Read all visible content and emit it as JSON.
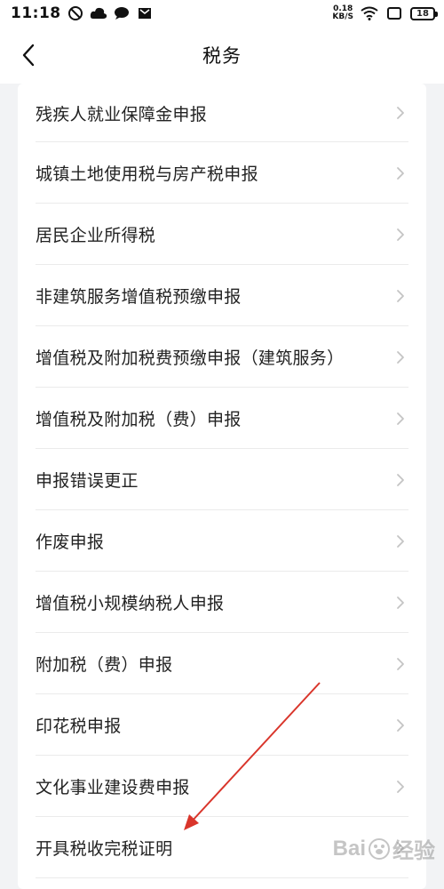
{
  "status_bar": {
    "time": "11:18",
    "net_speed_value": "0.18",
    "net_speed_unit": "KB/S",
    "battery": "18",
    "icons": [
      "alarm-off-icon",
      "cloud-icon",
      "chat-bubble-icon",
      "mail-icon",
      "wifi-icon",
      "screen-icon"
    ]
  },
  "nav": {
    "title": "税务",
    "back_icon": "chevron-left-icon"
  },
  "menu": {
    "items": [
      {
        "label": "残疾人就业保障金申报"
      },
      {
        "label": "城镇土地使用税与房产税申报"
      },
      {
        "label": "居民企业所得税"
      },
      {
        "label": "非建筑服务增值税预缴申报"
      },
      {
        "label": "增值税及附加税费预缴申报（建筑服务）"
      },
      {
        "label": "增值税及附加税（费）申报"
      },
      {
        "label": "申报错误更正"
      },
      {
        "label": "作废申报"
      },
      {
        "label": "增值税小规模纳税人申报"
      },
      {
        "label": "附加税（费）申报"
      },
      {
        "label": "印花税申报"
      },
      {
        "label": "文化事业建设费申报"
      },
      {
        "label": "开具税收完税证明"
      }
    ]
  },
  "colors": {
    "background": "#f2f3f5",
    "card": "#ffffff",
    "chevron": "#c4c4c4",
    "annotation_arrow": "#d9352b"
  },
  "watermark": {
    "text_en": "Bai",
    "text_cn": "经验"
  }
}
